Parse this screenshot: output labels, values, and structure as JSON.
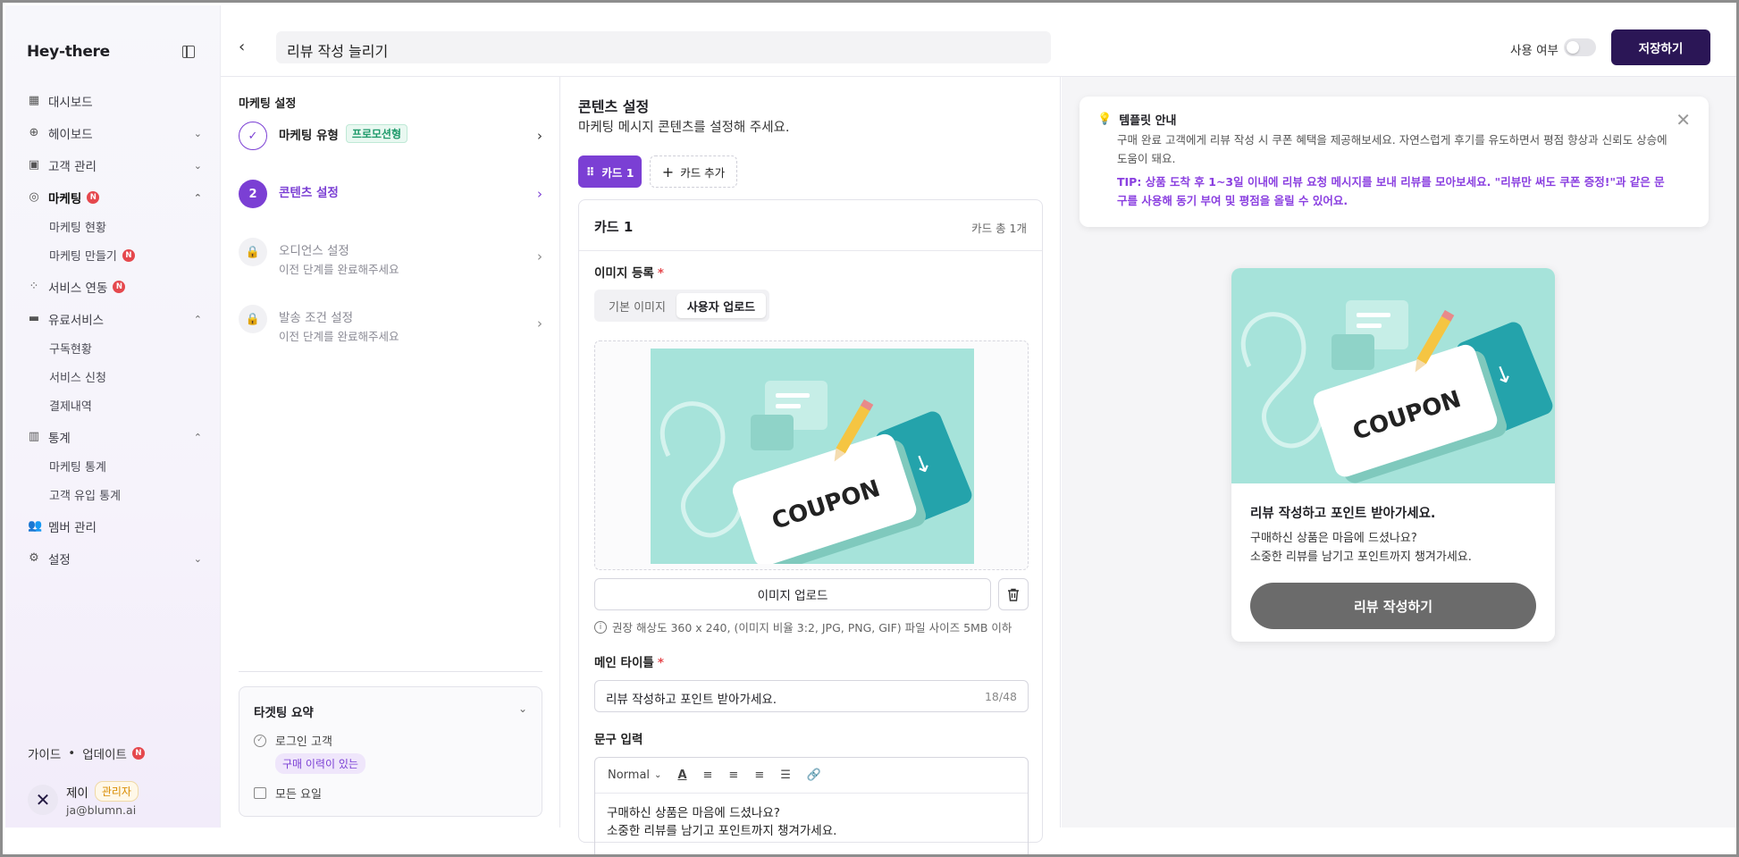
{
  "app": {
    "logo": "Hey-there"
  },
  "header": {
    "title_value": "리뷰 작성 늘리기",
    "use_label": "사용 여부",
    "save_label": "저장하기"
  },
  "sidebar": {
    "items": [
      {
        "label": "대시보드"
      },
      {
        "label": "헤이보드"
      },
      {
        "label": "고객 관리"
      },
      {
        "label": "마케팅",
        "badge": "N"
      },
      {
        "label": "마케팅 현황"
      },
      {
        "label": "마케팅 만들기",
        "badge": "N"
      },
      {
        "label": "서비스 연동",
        "badge": "N"
      },
      {
        "label": "유료서비스"
      },
      {
        "label": "구독현황"
      },
      {
        "label": "서비스 신청"
      },
      {
        "label": "결제내역"
      },
      {
        "label": "통계"
      },
      {
        "label": "마케팅 통계"
      },
      {
        "label": "고객 유입 통계"
      },
      {
        "label": "멤버 관리"
      },
      {
        "label": "설정"
      }
    ],
    "footer": {
      "guide": "가이드",
      "update": "업데이트",
      "update_badge": "N",
      "user_name": "제이",
      "role": "관리자",
      "email": "ja@blumn.ai"
    }
  },
  "steps": {
    "heading": "마케팅 설정",
    "items": [
      {
        "title": "마케팅 유형",
        "tag": "프로모션형",
        "sub": ""
      },
      {
        "num": "2",
        "title": "콘텐츠 설정",
        "sub": ""
      },
      {
        "title": "오디언스 설정",
        "sub": "이전 단계를 완료해주세요"
      },
      {
        "title": "발송 조건 설정",
        "sub": "이전 단계를 완료해주세요"
      }
    ],
    "summary": {
      "title": "타겟팅 요약",
      "row1": "로그인 고객",
      "chip": "구매 이력이 있는",
      "row2": "모든 요일"
    }
  },
  "content": {
    "title": "콘텐츠 설정",
    "subtitle": "마케팅 메시지 콘텐츠를 설정해 주세요.",
    "tab_card": "카드 1",
    "add_card": "카드 추가",
    "card_title": "카드 1",
    "card_count": "카드 총 1개",
    "image_label": "이미지 등록",
    "req": "*",
    "seg_default": "기본 이미지",
    "seg_user": "사용자 업로드",
    "upload_btn": "이미지 업로드",
    "hint": "권장 해상도 360 x 240, (이미지 비율 3:2, JPG, PNG, GIF) 파일 사이즈 5MB 이하",
    "main_title_label": "메인 타이틀",
    "main_title_value": "리뷰 작성하고 포인트 받아가세요.",
    "main_title_count": "18/48",
    "body_label": "문구 입력",
    "format": "Normal",
    "body_line1": "구매하신 상품은 마음에 드셨나요?",
    "body_line2": "소중한 리뷰를 남기고 포인트까지 챙겨가세요."
  },
  "coupon_text": "COUPON",
  "preview": {
    "tip_title": "템플릿 안내",
    "tip_desc": "구매 완료 고객에게 리뷰 작성 시 쿠폰 혜택을 제공해보세요. 자연스럽게 후기를 유도하면서 평점 향상과 신뢰도 상승에 도움이 돼요.",
    "tip_pro": "TIP: 상품 도착 후 1~3일 이내에 리뷰 요청 메시지를 보내 리뷰를 모아보세요. \"리뷰만 써도 쿠폰 증정!\"과 같은 문구를 사용해 동기 부여 및 평점을 올릴 수 있어요.",
    "card_title": "리뷰 작성하고 포인트 받아가세요.",
    "card_line1": "구매하신 상품은 마음에 드셨나요?",
    "card_line2": "소중한 리뷰를 남기고 포인트까지 챙겨가세요.",
    "cta": "리뷰 작성하기"
  },
  "colors": {
    "primary": "#2b1656",
    "accent": "#7b3fd4",
    "mint": "#a6e3da",
    "badge": "#e5484d"
  }
}
